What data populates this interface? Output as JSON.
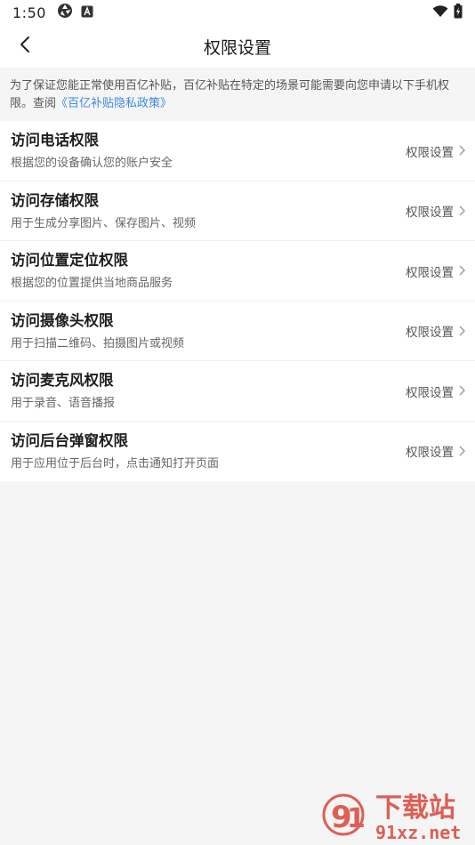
{
  "status_bar": {
    "time": "1:50",
    "icons": [
      "aperture-icon",
      "a-badge-icon",
      "wifi-icon",
      "battery-icon"
    ]
  },
  "header": {
    "title": "权限设置",
    "back_icon": "chevron-left-icon"
  },
  "notice": {
    "text": "为了保证您能正常使用百亿补贴，百亿补贴在特定的场景可能需要向您申请以下手机权限。查阅",
    "link": "《百亿补贴隐私政策》",
    "link_color": "#3d8ae0"
  },
  "permissions": [
    {
      "title": "访问电话权限",
      "desc": "根据您的设备确认您的账户安全",
      "action": "权限设置"
    },
    {
      "title": "访问存储权限",
      "desc": "用于生成分享图片、保存图片、视频",
      "action": "权限设置"
    },
    {
      "title": "访问位置定位权限",
      "desc": "根据您的位置提供当地商品服务",
      "action": "权限设置"
    },
    {
      "title": "访问摄像头权限",
      "desc": "用于扫描二维码、拍摄图片或视频",
      "action": "权限设置"
    },
    {
      "title": "访问麦克风权限",
      "desc": "用于录音、语音播报",
      "action": "权限设置"
    },
    {
      "title": "访问后台弹窗权限",
      "desc": "用于应用位于后台时，点击通知打开页面",
      "action": "权限设置"
    }
  ],
  "watermark": {
    "line1": "下载站",
    "line2": "91xz.net",
    "color": "#d9453a"
  }
}
